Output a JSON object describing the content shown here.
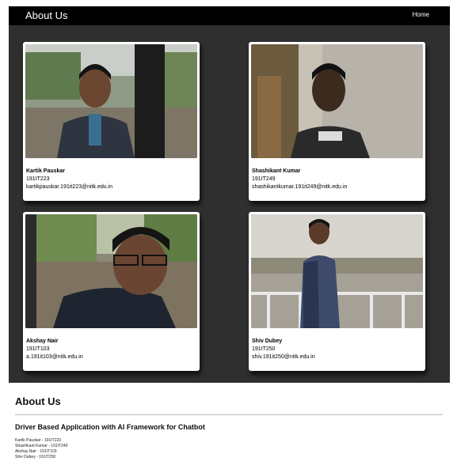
{
  "navbar": {
    "brand": "About Us",
    "home_link": "Home"
  },
  "team": [
    {
      "name": "Kartik Pauskar",
      "id": "191IT223",
      "email": "kartikpauskar.191it223@nitk.edu.in"
    },
    {
      "name": "Shashikant Kumar",
      "id": "191IT249",
      "email": "shashikantkumar.191it249@nitk.edu.in"
    },
    {
      "name": "Akshay Nair",
      "id": "191IT103",
      "email": "a.191it103@nitk.edu.in"
    },
    {
      "name": "Shiv Dubey",
      "id": "191IT250",
      "email": "shiv.191it250@nitk.edu.in"
    }
  ],
  "about": {
    "heading": "About Us",
    "project_title": "Driver Based Application with AI Framework for Chatbot",
    "members": [
      "Kartik Pauskar - 191IT223",
      "Shashikant Kumar - 191IT249",
      "Akshay Nair - 191IT103",
      "Shiv Dubey - 191IT250"
    ]
  },
  "colors": {
    "navbar_bg": "#000000",
    "gallery_bg": "#2f2f2f",
    "card_bg": "#ffffff"
  }
}
